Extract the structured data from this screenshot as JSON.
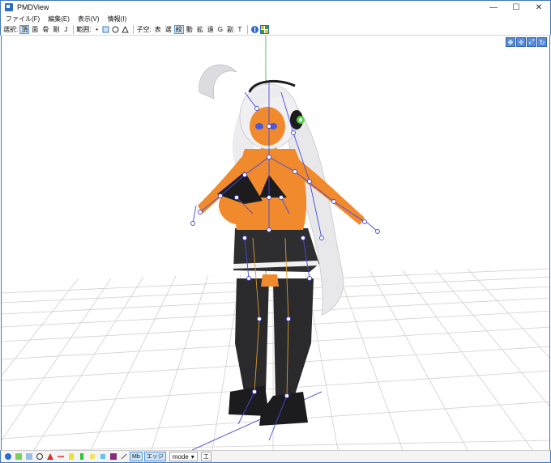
{
  "window": {
    "title": "PMDView",
    "minimize": "—",
    "maximize": "☐",
    "close": "✕"
  },
  "menu": [
    "ファイル(F)",
    "編集(E)",
    "表示(V)",
    "情報(I)"
  ],
  "toolbar": {
    "select_label": "選択:",
    "select_items": [
      "頂",
      "面",
      "骨",
      "剛",
      "J"
    ],
    "range_label": "範囲:",
    "range_dot": "•",
    "child_label": "子空:",
    "child_items": [
      "表",
      "選",
      "絞",
      "動",
      "拡",
      "遠",
      "G",
      "副",
      "T"
    ]
  },
  "colors": {
    "accent": "#3c78c8",
    "grid": "#cfcfcf",
    "skin": "#f08a2c",
    "bone": "#4a4ad8",
    "ik_bone": "#d89a30"
  },
  "statusbar": {
    "edge_label": "エッジ",
    "pmx_label": "Mb",
    "mode": "mode",
    "mode_arrow": "▾",
    "text_icon": "工"
  }
}
